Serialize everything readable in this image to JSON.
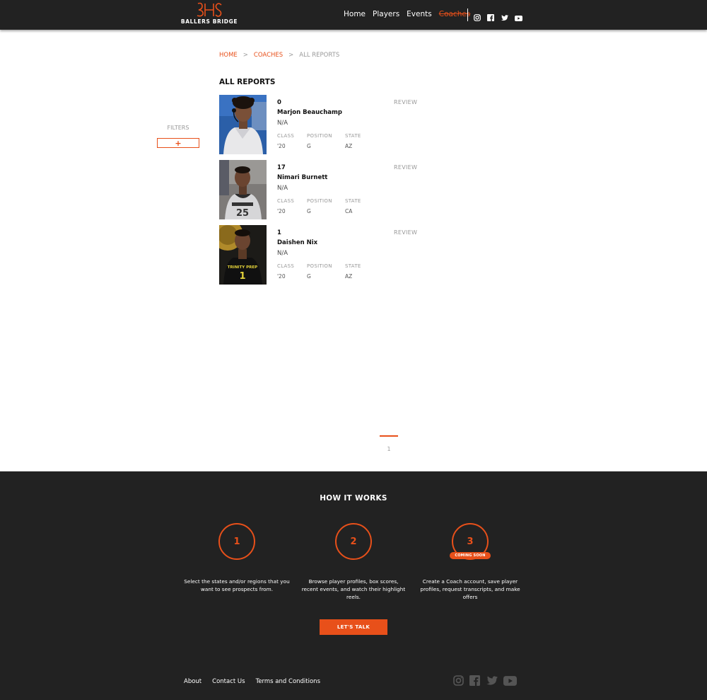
{
  "header": {
    "logo_text": "BALLERS BRIDGE",
    "nav": [
      {
        "label": "Home"
      },
      {
        "label": "Players"
      },
      {
        "label": "Events"
      },
      {
        "label": "Coaches",
        "active": true
      }
    ],
    "social_icons": [
      "instagram-icon",
      "facebook-icon",
      "twitter-icon",
      "youtube-icon"
    ]
  },
  "breadcrumb": {
    "items": [
      "HOME",
      "COACHES",
      "ALL REPORTS"
    ],
    "separator": ">"
  },
  "page_title": "ALL REPORTS",
  "filters": {
    "label": "FILTERS",
    "add_glyph": "+"
  },
  "reports": {
    "review_label": "REVIEW",
    "columns": [
      "CLASS",
      "POSITION",
      "STATE"
    ],
    "items": [
      {
        "rank": "0",
        "name": "Marjon Beauchamp",
        "school": "N/A",
        "class": "'20",
        "position": "G",
        "state": "AZ"
      },
      {
        "rank": "17",
        "name": "Nimari Burnett",
        "school": "N/A",
        "class": "'20",
        "position": "G",
        "state": "CA"
      },
      {
        "rank": "1",
        "name": "Daishen Nix",
        "school": "N/A",
        "class": "'20",
        "position": "G",
        "state": "AZ"
      }
    ]
  },
  "pagination": {
    "current": "1"
  },
  "footer": {
    "how_title": "HOW IT WORKS",
    "steps": [
      {
        "number": "1",
        "text": "Select the states and/or regions that you want to see prospects from."
      },
      {
        "number": "2",
        "text": "Browse player profiles, box scores, recent events, and watch their highlight reels."
      },
      {
        "number": "3",
        "text": "Create a Coach account, save player profiles, request transcripts, and make offers",
        "badge": "COMING SOON"
      }
    ],
    "cta_label": "LET'S TALK",
    "links": [
      "About",
      "Contact Us",
      "Terms and Conditions"
    ]
  },
  "colors": {
    "accent": "#e8501a",
    "dark": "#222222"
  }
}
